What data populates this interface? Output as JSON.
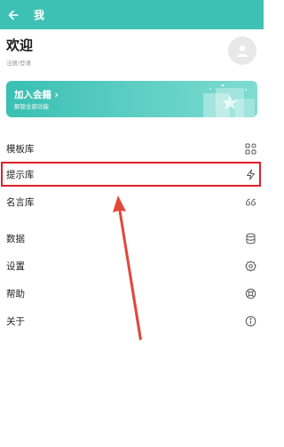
{
  "colors": {
    "teal": "#3ec1b5",
    "teal_light": "#6fd7cc",
    "highlight_red": "#e0202a",
    "arrow_red": "#e0483c"
  },
  "appbar": {
    "title": "我",
    "back_icon": "arrow-left-icon"
  },
  "welcome": {
    "title": "欢迎",
    "subtitle": "注册/登录",
    "avatar_icon": "person-icon"
  },
  "vip": {
    "title": "加入会籍 ›",
    "subtitle": "解锁全部功能"
  },
  "menu": [
    {
      "label": "模板库",
      "icon": "grid-icon"
    },
    {
      "label": "提示库",
      "icon": "lightning-icon",
      "highlighted": true
    },
    {
      "label": "名言库",
      "icon": "quote-icon"
    },
    {
      "label": "数据",
      "icon": "database-icon"
    },
    {
      "label": "设置",
      "icon": "gear-icon"
    },
    {
      "label": "帮助",
      "icon": "lifebuoy-icon"
    },
    {
      "label": "关于",
      "icon": "info-icon"
    }
  ]
}
